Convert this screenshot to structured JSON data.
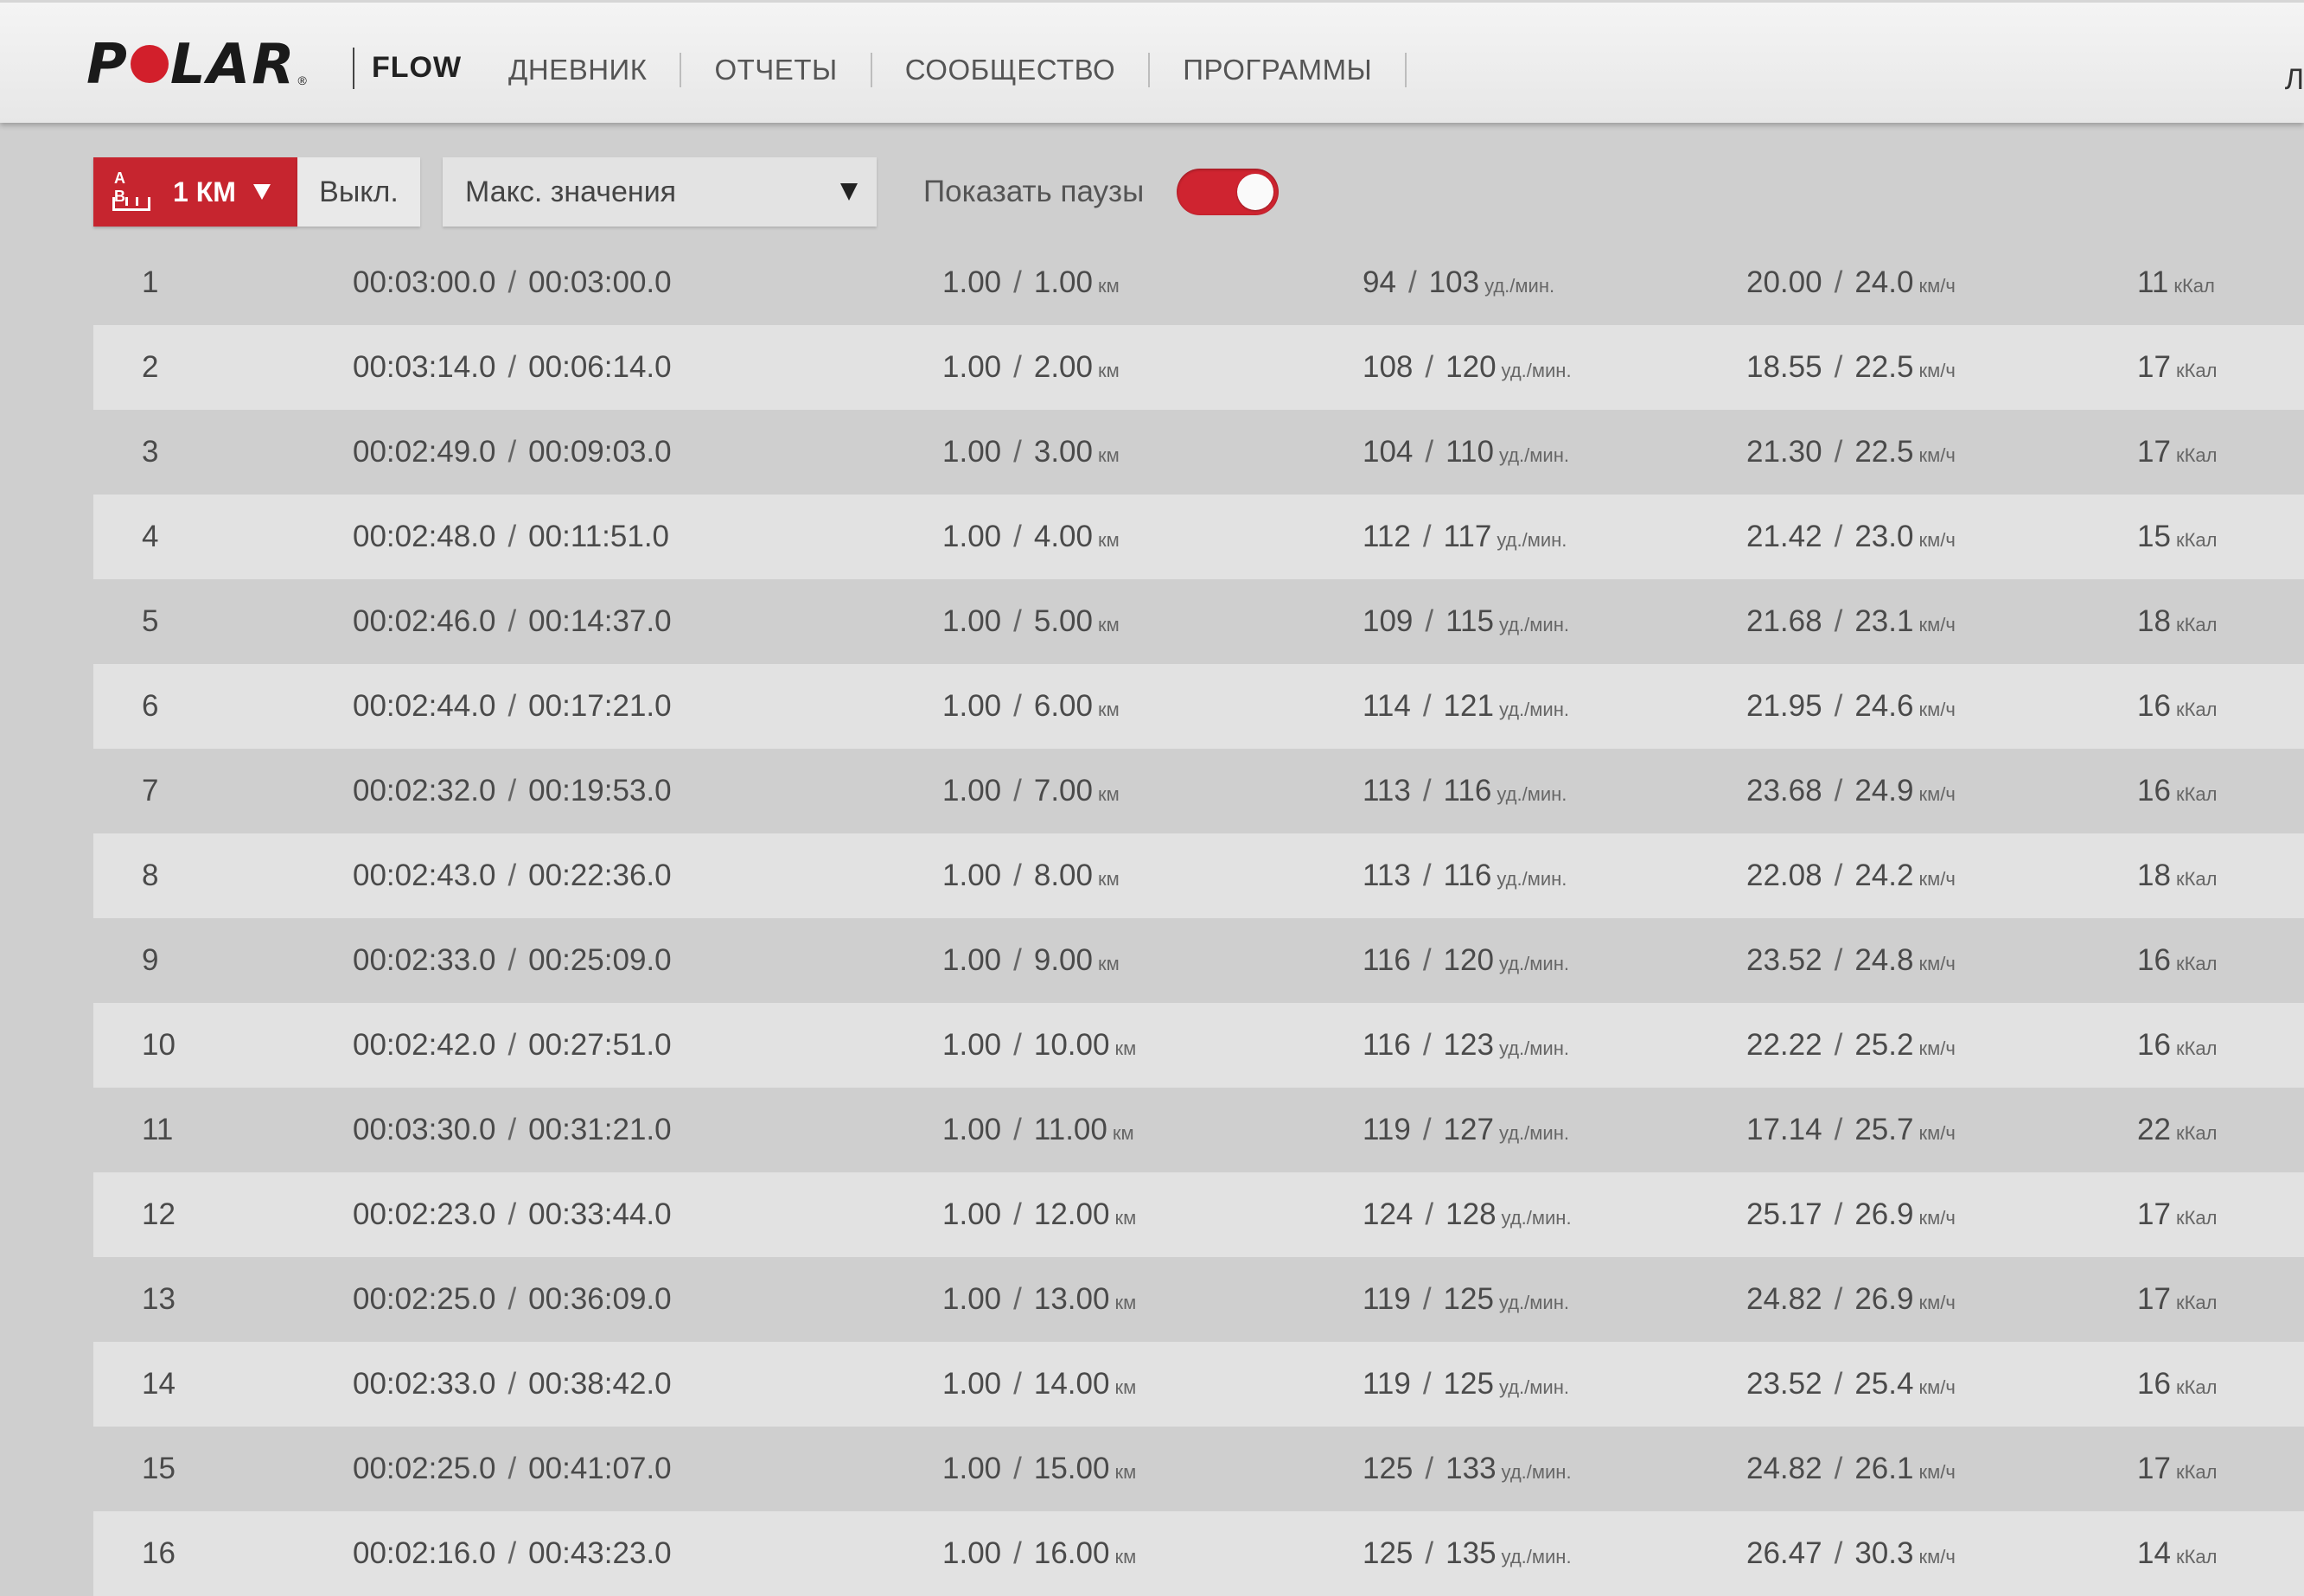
{
  "nav": {
    "logo": "POLAR",
    "product": "FLOW",
    "items": [
      "ДНЕВНИК",
      "ОТЧЕТЫ",
      "СООБЩЕСТВО",
      "ПРОГРАММЫ"
    ],
    "edge_glyph": "Л"
  },
  "controls": {
    "lap_icon_letters": "A B",
    "lap_length": "1 КМ",
    "off_label": "Выкл.",
    "metric_select": "Макс. значения",
    "pause_label": "Показать паузы",
    "pause_toggle_on": true,
    "colors": {
      "accent": "#c6252f"
    }
  },
  "units": {
    "dist": "км",
    "hr": "уд./мин.",
    "spd": "км/ч",
    "cal": "кКал"
  },
  "laps": [
    {
      "n": "1",
      "time": "00:03:00.0",
      "total": "00:03:00.0",
      "dist": "1.00",
      "dist_total": "1.00",
      "hr_avg": "94",
      "hr_max": "103",
      "spd_avg": "20.00",
      "spd_max": "24.0",
      "cal": "11"
    },
    {
      "n": "2",
      "time": "00:03:14.0",
      "total": "00:06:14.0",
      "dist": "1.00",
      "dist_total": "2.00",
      "hr_avg": "108",
      "hr_max": "120",
      "spd_avg": "18.55",
      "spd_max": "22.5",
      "cal": "17"
    },
    {
      "n": "3",
      "time": "00:02:49.0",
      "total": "00:09:03.0",
      "dist": "1.00",
      "dist_total": "3.00",
      "hr_avg": "104",
      "hr_max": "110",
      "spd_avg": "21.30",
      "spd_max": "22.5",
      "cal": "17"
    },
    {
      "n": "4",
      "time": "00:02:48.0",
      "total": "00:11:51.0",
      "dist": "1.00",
      "dist_total": "4.00",
      "hr_avg": "112",
      "hr_max": "117",
      "spd_avg": "21.42",
      "spd_max": "23.0",
      "cal": "15"
    },
    {
      "n": "5",
      "time": "00:02:46.0",
      "total": "00:14:37.0",
      "dist": "1.00",
      "dist_total": "5.00",
      "hr_avg": "109",
      "hr_max": "115",
      "spd_avg": "21.68",
      "spd_max": "23.1",
      "cal": "18"
    },
    {
      "n": "6",
      "time": "00:02:44.0",
      "total": "00:17:21.0",
      "dist": "1.00",
      "dist_total": "6.00",
      "hr_avg": "114",
      "hr_max": "121",
      "spd_avg": "21.95",
      "spd_max": "24.6",
      "cal": "16"
    },
    {
      "n": "7",
      "time": "00:02:32.0",
      "total": "00:19:53.0",
      "dist": "1.00",
      "dist_total": "7.00",
      "hr_avg": "113",
      "hr_max": "116",
      "spd_avg": "23.68",
      "spd_max": "24.9",
      "cal": "16"
    },
    {
      "n": "8",
      "time": "00:02:43.0",
      "total": "00:22:36.0",
      "dist": "1.00",
      "dist_total": "8.00",
      "hr_avg": "113",
      "hr_max": "116",
      "spd_avg": "22.08",
      "spd_max": "24.2",
      "cal": "18"
    },
    {
      "n": "9",
      "time": "00:02:33.0",
      "total": "00:25:09.0",
      "dist": "1.00",
      "dist_total": "9.00",
      "hr_avg": "116",
      "hr_max": "120",
      "spd_avg": "23.52",
      "spd_max": "24.8",
      "cal": "16"
    },
    {
      "n": "10",
      "time": "00:02:42.0",
      "total": "00:27:51.0",
      "dist": "1.00",
      "dist_total": "10.00",
      "hr_avg": "116",
      "hr_max": "123",
      "spd_avg": "22.22",
      "spd_max": "25.2",
      "cal": "16"
    },
    {
      "n": "11",
      "time": "00:03:30.0",
      "total": "00:31:21.0",
      "dist": "1.00",
      "dist_total": "11.00",
      "hr_avg": "119",
      "hr_max": "127",
      "spd_avg": "17.14",
      "spd_max": "25.7",
      "cal": "22"
    },
    {
      "n": "12",
      "time": "00:02:23.0",
      "total": "00:33:44.0",
      "dist": "1.00",
      "dist_total": "12.00",
      "hr_avg": "124",
      "hr_max": "128",
      "spd_avg": "25.17",
      "spd_max": "26.9",
      "cal": "17"
    },
    {
      "n": "13",
      "time": "00:02:25.0",
      "total": "00:36:09.0",
      "dist": "1.00",
      "dist_total": "13.00",
      "hr_avg": "119",
      "hr_max": "125",
      "spd_avg": "24.82",
      "spd_max": "26.9",
      "cal": "17"
    },
    {
      "n": "14",
      "time": "00:02:33.0",
      "total": "00:38:42.0",
      "dist": "1.00",
      "dist_total": "14.00",
      "hr_avg": "119",
      "hr_max": "125",
      "spd_avg": "23.52",
      "spd_max": "25.4",
      "cal": "16"
    },
    {
      "n": "15",
      "time": "00:02:25.0",
      "total": "00:41:07.0",
      "dist": "1.00",
      "dist_total": "15.00",
      "hr_avg": "125",
      "hr_max": "133",
      "spd_avg": "24.82",
      "spd_max": "26.1",
      "cal": "17"
    },
    {
      "n": "16",
      "time": "00:02:16.0",
      "total": "00:43:23.0",
      "dist": "1.00",
      "dist_total": "16.00",
      "hr_avg": "125",
      "hr_max": "135",
      "spd_avg": "26.47",
      "spd_max": "30.3",
      "cal": "14"
    }
  ]
}
